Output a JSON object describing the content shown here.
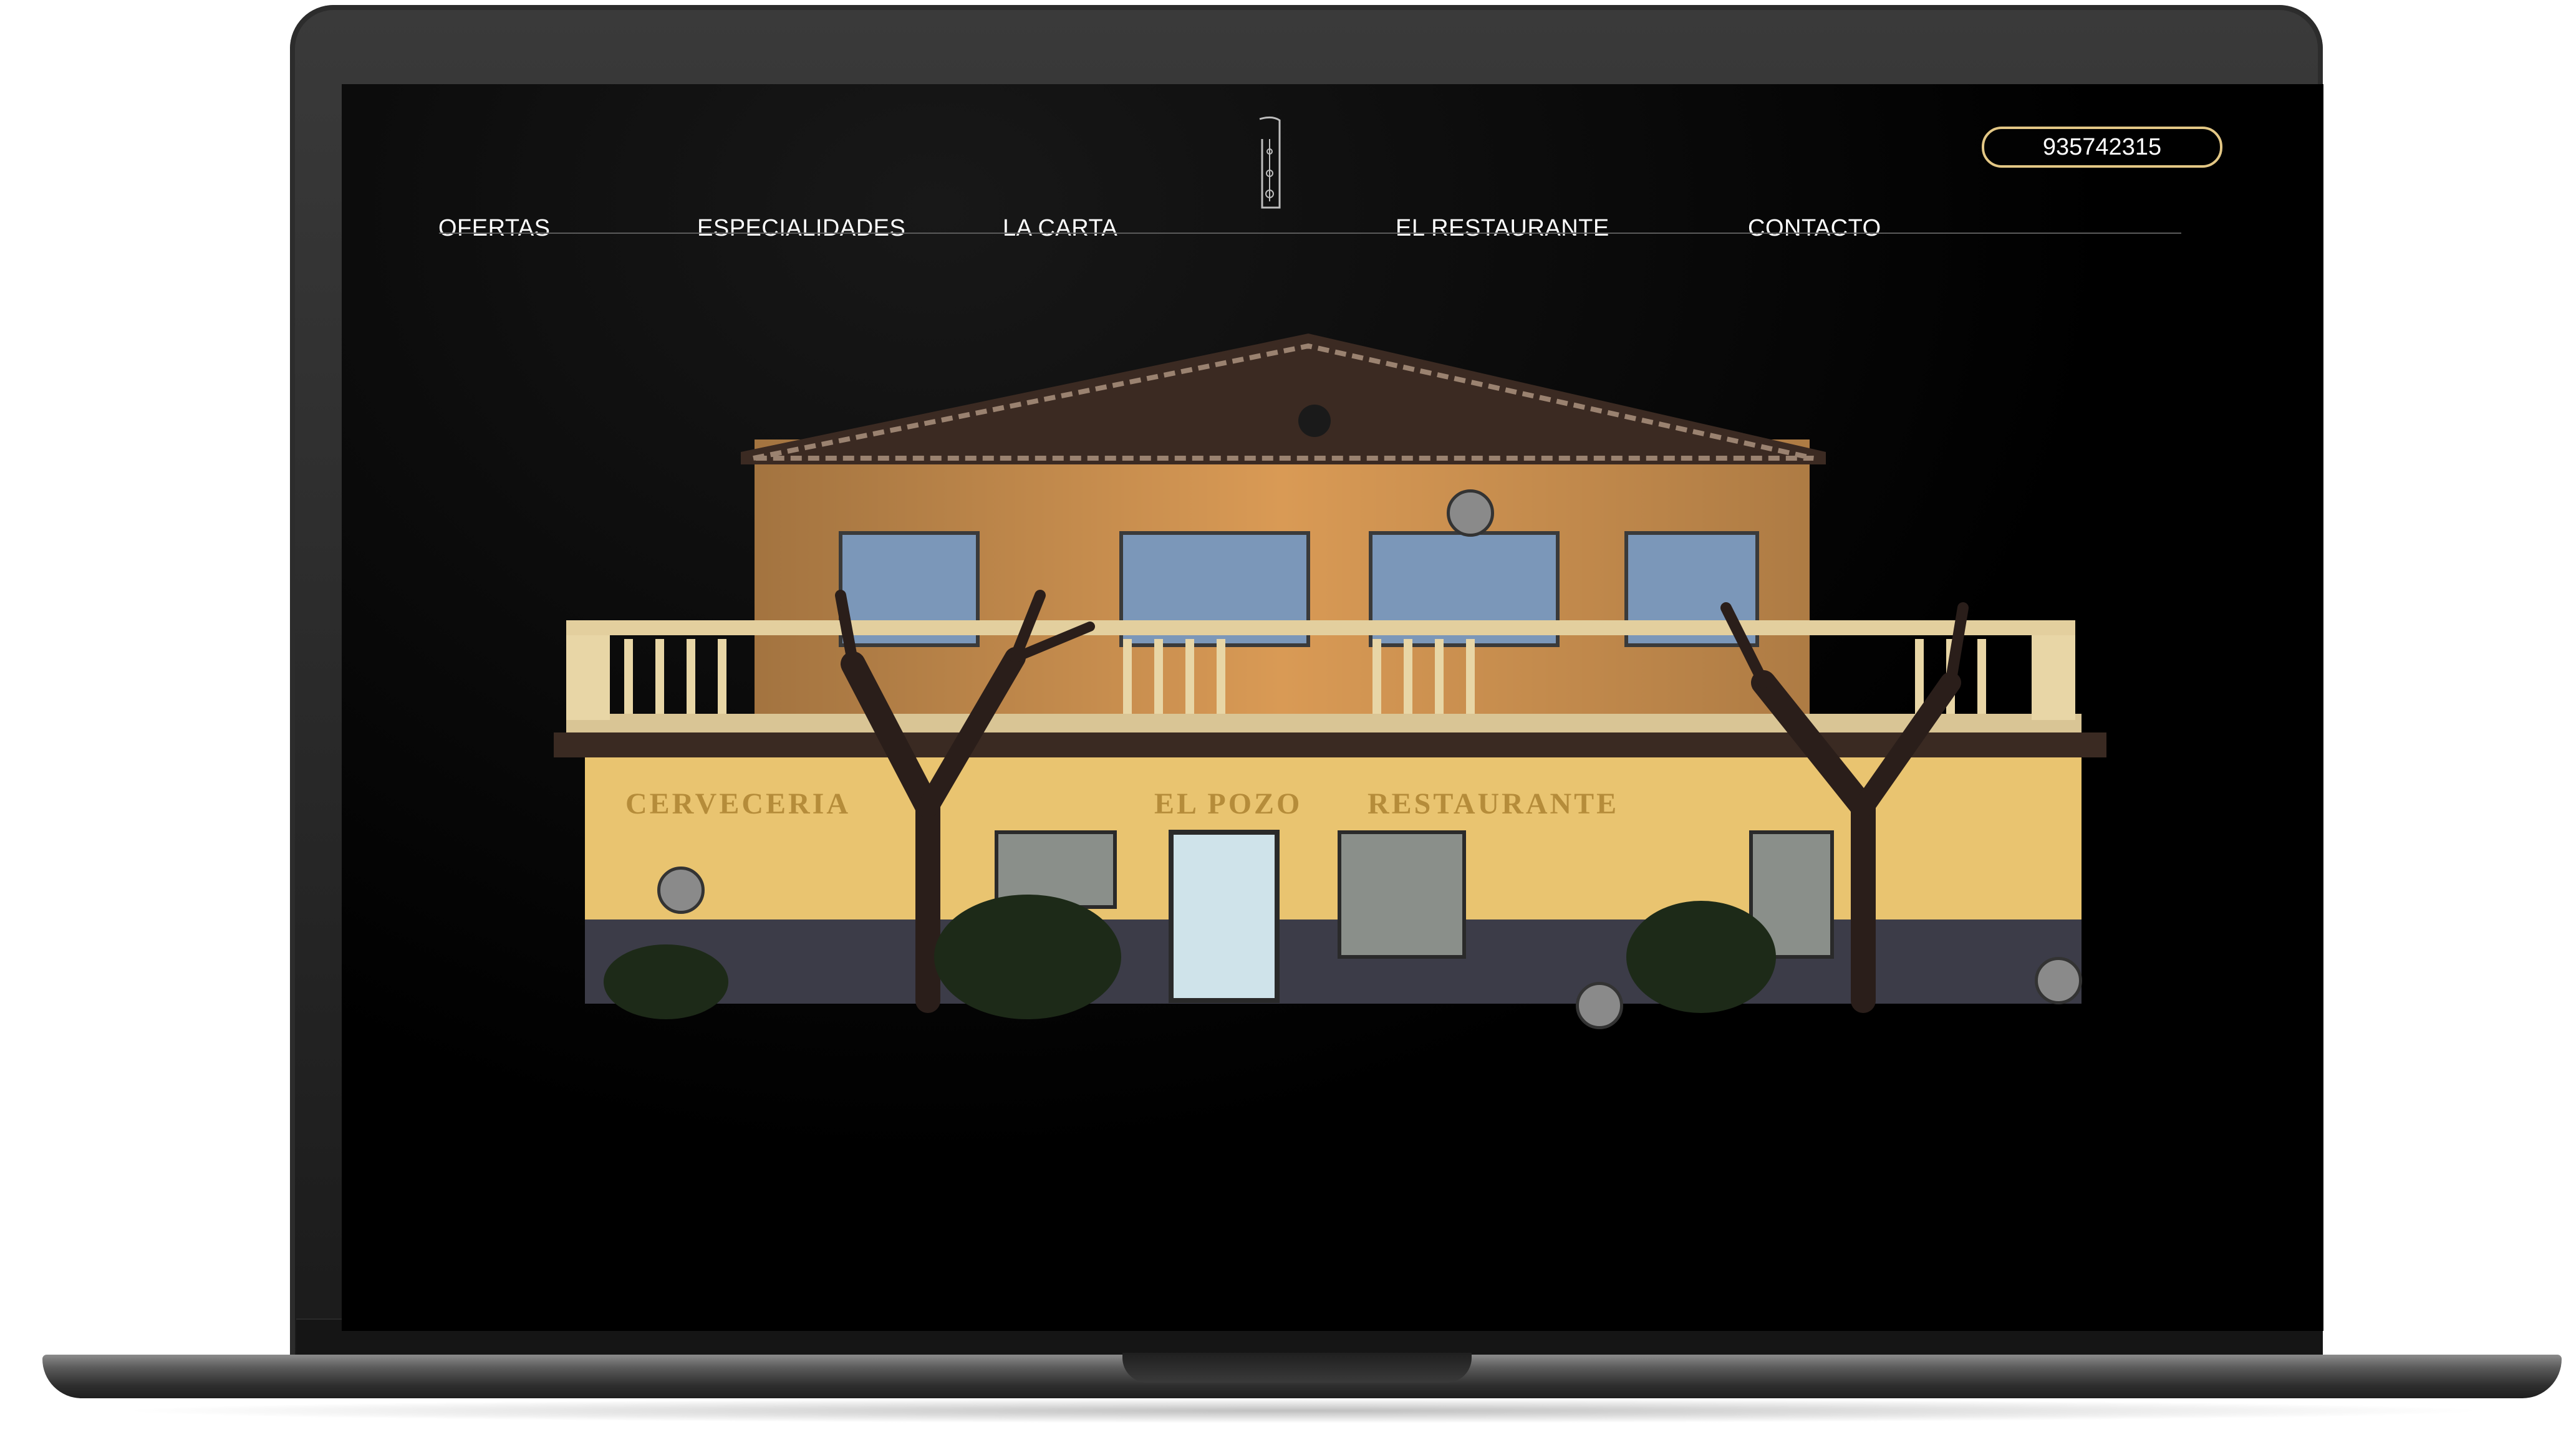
{
  "nav": {
    "left_items": [
      "OFERTAS",
      "ESPECIALIDADES",
      "LA CARTA"
    ],
    "right_items": [
      "EL RESTAURANTE",
      "CONTACTO"
    ],
    "phone": "935742315",
    "logo": "logo-icon"
  },
  "hero": {
    "sign_left": "CERVECERIA",
    "sign_center": "EL POZO",
    "sign_right": "RESTAURANTE"
  },
  "colors": {
    "accent": "#e3c785",
    "background": "#000000",
    "facade": "#e9b566",
    "brick": "#d99a55"
  }
}
